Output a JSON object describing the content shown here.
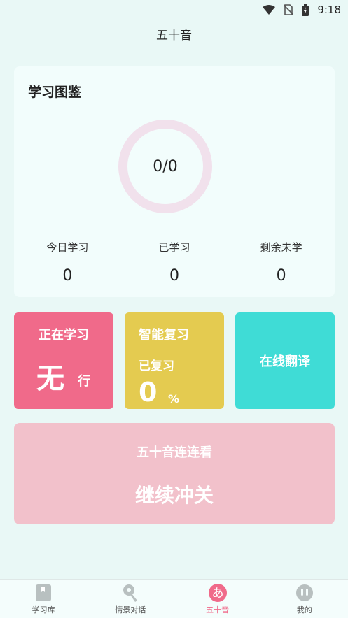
{
  "status_bar": {
    "time": "9:18"
  },
  "header": {
    "title": "五十音"
  },
  "study_card": {
    "title": "学习图鉴",
    "progress_text": "0/0",
    "stats": [
      {
        "label": "今日学习",
        "value": "0"
      },
      {
        "label": "已学习",
        "value": "0"
      },
      {
        "label": "剩余未学",
        "value": "0"
      }
    ]
  },
  "tiles": {
    "learning": {
      "title": "正在学习",
      "value": "无",
      "unit": "行"
    },
    "review": {
      "title": "智能复习",
      "subtitle": "已复习",
      "value": "0",
      "unit": "%"
    },
    "translate": {
      "title": "在线翻译"
    }
  },
  "banner": {
    "title": "五十音连连看",
    "action": "继续冲关"
  },
  "tabbar": {
    "items": [
      {
        "label": "学习库",
        "icon": "book-icon"
      },
      {
        "label": "情景对话",
        "icon": "key-icon"
      },
      {
        "label": "五十音",
        "icon": "hiragana-a-icon",
        "glyph": "あ"
      },
      {
        "label": "我的",
        "icon": "profile-icon"
      }
    ],
    "active_color": "#f06a8a"
  }
}
